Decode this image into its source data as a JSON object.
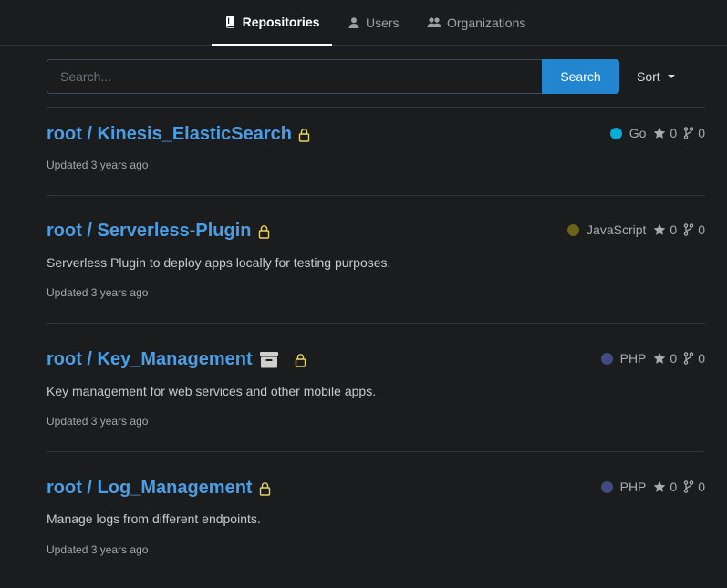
{
  "nav": {
    "tabs": [
      {
        "label": "Repositories",
        "icon": "repo-icon",
        "active": true
      },
      {
        "label": "Users",
        "icon": "user-icon",
        "active": false
      },
      {
        "label": "Organizations",
        "icon": "organization-icon",
        "active": false
      }
    ]
  },
  "search": {
    "placeholder": "Search...",
    "value": "",
    "button_label": "Search"
  },
  "sort": {
    "label": "Sort"
  },
  "repos": [
    {
      "owner": "root",
      "name": "Kinesis_ElasticSearch",
      "full_name": "root / Kinesis_ElasticSearch",
      "private": true,
      "archived": false,
      "description": "",
      "updated": "Updated 3 years ago",
      "language": "Go",
      "language_color": "#00add8",
      "stars": "0",
      "forks": "0"
    },
    {
      "owner": "root",
      "name": "Serverless-Plugin",
      "full_name": "root / Serverless-Plugin",
      "private": true,
      "archived": false,
      "description": "Serverless Plugin to deploy apps locally for testing purposes.",
      "updated": "Updated 3 years ago",
      "language": "JavaScript",
      "language_color": "#6b6318",
      "stars": "0",
      "forks": "0"
    },
    {
      "owner": "root",
      "name": "Key_Management",
      "full_name": "root / Key_Management",
      "private": true,
      "archived": true,
      "description": "Key management for web services and other mobile apps.",
      "updated": "Updated 3 years ago",
      "language": "PHP",
      "language_color": "#404b82",
      "stars": "0",
      "forks": "0"
    },
    {
      "owner": "root",
      "name": "Log_Management",
      "full_name": "root / Log_Management",
      "private": true,
      "archived": false,
      "description": "Manage logs from different endpoints.",
      "updated": "Updated 3 years ago",
      "language": "PHP",
      "language_color": "#404b82",
      "stars": "0",
      "forks": "0"
    }
  ],
  "colors": {
    "background": "#1b1c1d",
    "link": "#4b9ee6",
    "primary_button": "#2185d0",
    "lock": "#e6d469",
    "divider": "#333538"
  }
}
